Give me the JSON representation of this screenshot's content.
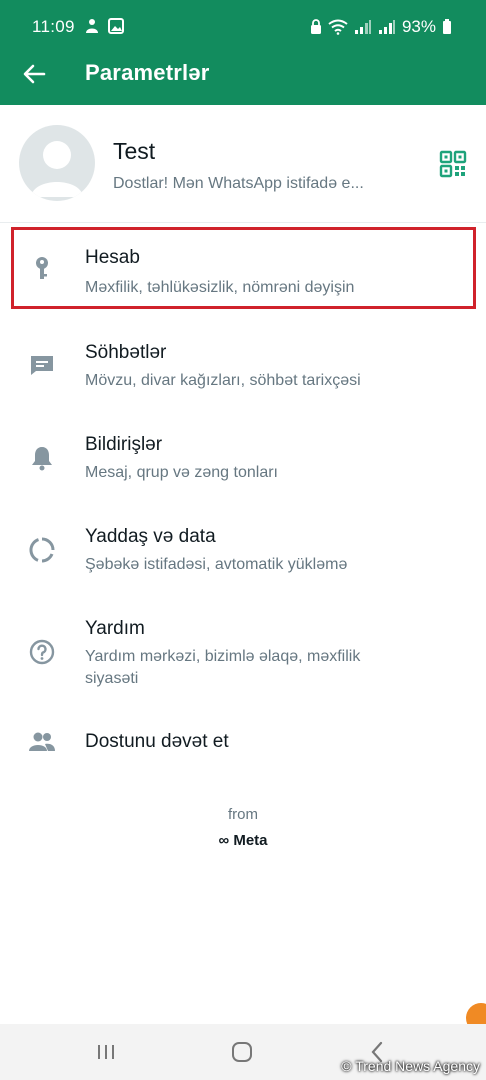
{
  "status_bar": {
    "time": "11:09",
    "battery": "93%"
  },
  "header": {
    "title": "Parametrlər",
    "color": "#128c5e"
  },
  "profile": {
    "name": "Test",
    "status": "Dostlar! Mən WhatsApp istifadə e..."
  },
  "settings": [
    {
      "label": "Hesab",
      "sub": "Məxfilik, təhlükəsizlik, nömrəni dəyişin",
      "icon": "key-icon"
    },
    {
      "label": "Söhbətlər",
      "sub": "Mövzu, divar kağızları, söhbət tarixçəsi",
      "icon": "chat-icon"
    },
    {
      "label": "Bildirişlər",
      "sub": "Mesaj, qrup və zəng tonları",
      "icon": "bell-icon"
    },
    {
      "label": "Yaddaş və data",
      "sub": "Şəbəkə istifadəsi, avtomatik yükləmə",
      "icon": "data-usage-icon"
    },
    {
      "label": "Yardım",
      "sub": "Yardım mərkəzi, bizimlə əlaqə, məxfilik siyasəti",
      "icon": "help-icon"
    },
    {
      "label": "Dostunu dəvət et",
      "sub": "",
      "icon": "people-icon"
    }
  ],
  "footer": {
    "from": "from",
    "brand": "∞ Meta"
  },
  "watermark": "© Trend News Agency"
}
